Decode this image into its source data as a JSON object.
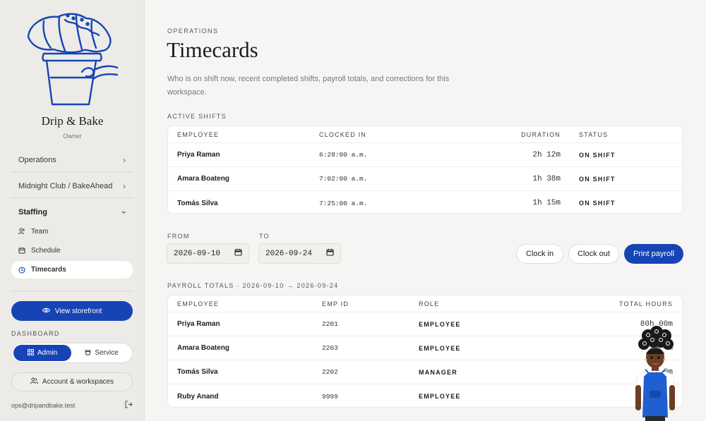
{
  "sidebar": {
    "brand": "Drip & Bake",
    "role": "Owner",
    "nav": {
      "operations": "Operations",
      "midnight": "Midnight Club / BakeAhead",
      "staffing": "Staffing"
    },
    "staffing_items": [
      {
        "label": "Team",
        "icon": "users-icon"
      },
      {
        "label": "Schedule",
        "icon": "calendar-icon"
      },
      {
        "label": "Timecards",
        "icon": "clock-icon",
        "active": true
      }
    ],
    "storefront_button": "View storefront",
    "dashboard_label": "DASHBOARD",
    "segmented": {
      "admin": "Admin",
      "service": "Service",
      "selected": "Admin"
    },
    "account_button": "Account & workspaces",
    "email": "ops@dripandbake.test"
  },
  "main": {
    "eyebrow": "OPERATIONS",
    "title": "Timecards",
    "description": "Who is on shift now, recent completed shifts, payroll totals, and corrections for this workspace.",
    "active_shifts": {
      "label": "ACTIVE SHIFTS",
      "columns": {
        "employee": "EMPLOYEE",
        "clocked_in": "CLOCKED IN",
        "duration": "DURATION",
        "status": "STATUS"
      },
      "rows": [
        {
          "employee": "Priya Raman",
          "clocked_in": "6:28:00 a.m.",
          "duration": "2h 12m",
          "status": "ON SHIFT"
        },
        {
          "employee": "Amara Boateng",
          "clocked_in": "7:02:00 a.m.",
          "duration": "1h 38m",
          "status": "ON SHIFT"
        },
        {
          "employee": "Tomás Silva",
          "clocked_in": "7:25:00 a.m.",
          "duration": "1h 15m",
          "status": "ON SHIFT"
        }
      ]
    },
    "filters": {
      "from_label": "FROM",
      "from_value": "2026-09-10",
      "to_label": "TO",
      "to_value": "2026-09-24"
    },
    "actions": {
      "clock_in": "Clock in",
      "clock_out": "Clock out",
      "print_payroll": "Print payroll"
    },
    "payroll": {
      "label": "PAYROLL TOTALS · 2026-09-10 → 2026-09-24",
      "columns": {
        "employee": "EMPLOYEE",
        "emp_id": "EMP ID",
        "role": "ROLE",
        "total_hours": "TOTAL HOURS"
      },
      "rows": [
        {
          "employee": "Priya Raman",
          "emp_id": "2201",
          "role": "EMPLOYEE",
          "total_hours": "80h 00m"
        },
        {
          "employee": "Amara Boateng",
          "emp_id": "2203",
          "role": "EMPLOYEE",
          "total_hours": "m"
        },
        {
          "employee": "Tomás Silva",
          "emp_id": "2202",
          "role": "MANAGER",
          "total_hours": "0m"
        },
        {
          "employee": "Ruby Anand",
          "emp_id": "9999",
          "role": "EMPLOYEE",
          "total_hours": ""
        }
      ]
    }
  },
  "colors": {
    "accent": "#1744b5",
    "sidebar_bg": "#ecebe7",
    "page_bg": "#f6f5f3"
  }
}
